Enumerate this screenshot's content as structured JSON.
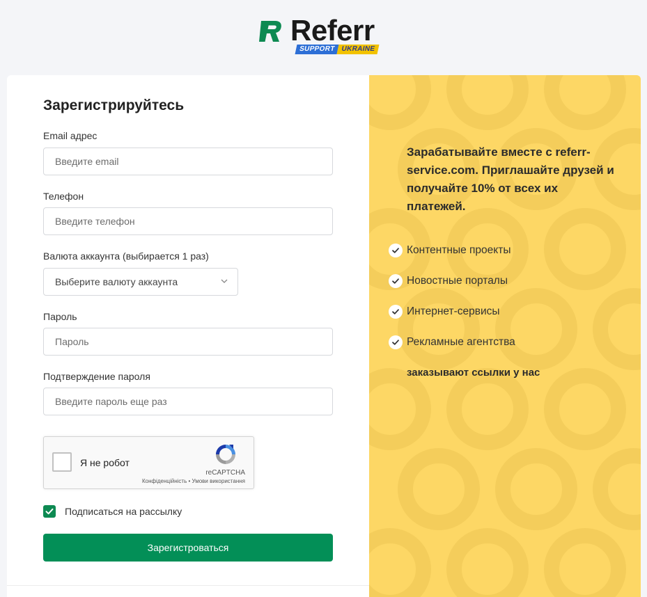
{
  "brand": {
    "name": "Referr",
    "support_left": "SUPPORT",
    "support_right": "UKRAINE",
    "mark_color": "#0d8a52"
  },
  "form": {
    "title": "Зарегистрируйтесь",
    "email": {
      "label": "Email адрес",
      "placeholder": "Введите email"
    },
    "phone": {
      "label": "Телефон",
      "placeholder": "Введите телефон"
    },
    "currency": {
      "label": "Валюта аккаунта (выбирается 1 раз)",
      "value": "Выберите валюту аккаунта"
    },
    "password": {
      "label": "Пароль",
      "placeholder": "Пароль"
    },
    "password_confirm": {
      "label": "Подтверждение пароля",
      "placeholder": "Введите пароль еще раз"
    },
    "captcha": {
      "label": "Я не робот",
      "brand": "reCAPTCHA",
      "terms": "Конфіденційність • Умови використання"
    },
    "newsletter": {
      "label": "Подписаться на рассылку",
      "checked": true
    },
    "submit_label": "Зарегистроваться"
  },
  "promo": {
    "headline": "Зарабатывайте вместе с referr-service.com. Приглашайте друзей и получайте 10% от всех их платежей.",
    "features": [
      "Контентные проекты",
      "Новостные порталы",
      "Интернет-сервисы",
      "Рекламные агентства"
    ],
    "tagline": "заказывают ссылки у нас",
    "panel_color": "#fdd765"
  },
  "colors": {
    "accent": "#038f57",
    "background": "#f4f5f8"
  }
}
